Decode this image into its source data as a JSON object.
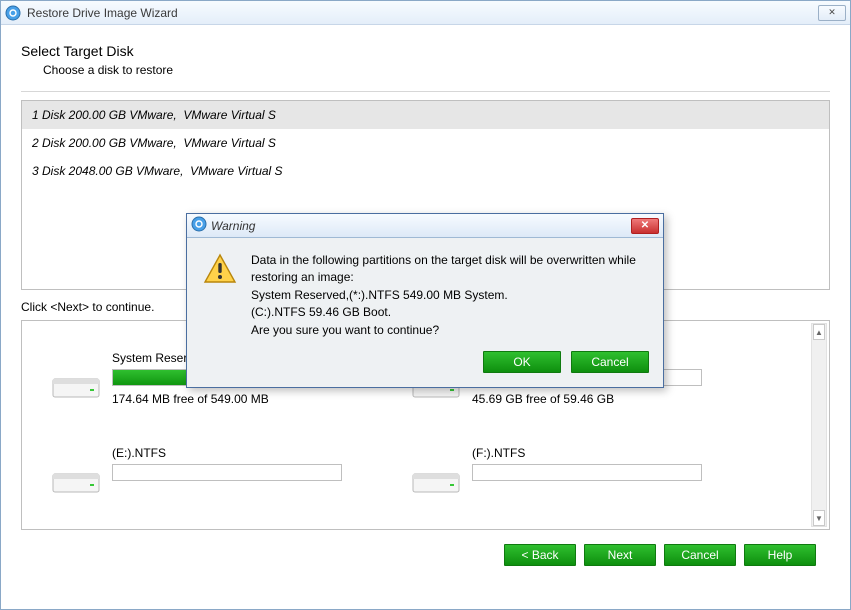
{
  "window": {
    "title": "Restore Drive Image Wizard",
    "heading": "Select Target Disk",
    "subheading": "Choose a disk to restore",
    "continue_text": "Click <Next> to continue."
  },
  "disks": [
    {
      "label": "1 Disk 200.00 GB VMware,  VMware Virtual S",
      "selected": true
    },
    {
      "label": "2 Disk 200.00 GB VMware,  VMware Virtual S",
      "selected": false
    },
    {
      "label": "3 Disk 2048.00 GB VMware,  VMware Virtual S",
      "selected": false
    }
  ],
  "partitions": [
    {
      "label": "System Reserved,(*:).NTFS",
      "free": "174.64 MB free of 549.00 MB",
      "fill_pct": 68
    },
    {
      "label": "(C:).NTFS",
      "free": "45.69 GB free of 59.46 GB",
      "fill_pct": 23
    },
    {
      "label": "(E:).NTFS",
      "free": "",
      "fill_pct": 0
    },
    {
      "label": "(F:).NTFS",
      "free": "",
      "fill_pct": 0
    }
  ],
  "buttons": {
    "back": "< Back",
    "next": "Next",
    "cancel": "Cancel",
    "help": "Help"
  },
  "modal": {
    "title": "Warning",
    "text": "Data in the following partitions on the target disk will be overwritten while restoring an image:\nSystem Reserved,(*:).NTFS 549.00 MB System.\n(C:).NTFS 59.46 GB Boot.\nAre you sure you want to continue?",
    "ok": "OK",
    "cancel": "Cancel"
  }
}
